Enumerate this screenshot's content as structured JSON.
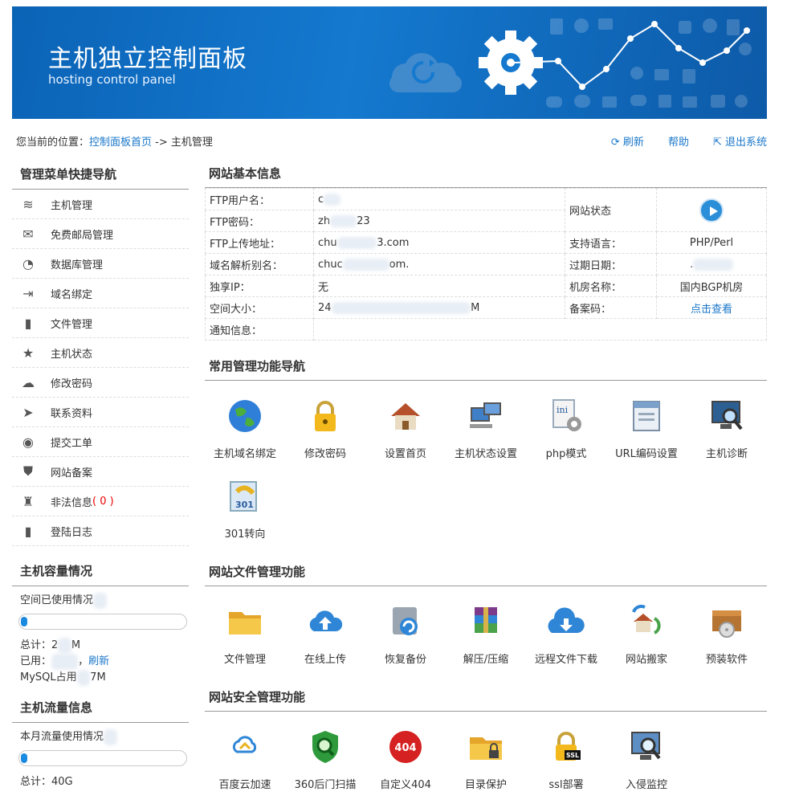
{
  "banner": {
    "title": "主机独立控制面板",
    "subtitle": "hosting control panel"
  },
  "breadcrumb": {
    "prefix": "您当前的位置：",
    "home": "控制面板首页",
    "sep": " -> ",
    "current": "主机管理"
  },
  "topnav": {
    "refresh": "刷新",
    "help": "帮助",
    "logout": "退出系统"
  },
  "sidebar": {
    "menu_title": "管理菜单快捷导航",
    "items": [
      {
        "label": "主机管理",
        "icon": "database-icon"
      },
      {
        "label": "免费邮局管理",
        "icon": "mail-icon"
      },
      {
        "label": "数据库管理",
        "icon": "pie-chart-icon"
      },
      {
        "label": "域名绑定",
        "icon": "sign-in-icon"
      },
      {
        "label": "文件管理",
        "icon": "file-icon"
      },
      {
        "label": "主机状态",
        "icon": "star-icon"
      },
      {
        "label": "修改密码",
        "icon": "cloud-refresh-icon"
      },
      {
        "label": "联系资料",
        "icon": "send-icon"
      },
      {
        "label": "提交工单",
        "icon": "user-circle-icon"
      },
      {
        "label": "网站备案",
        "icon": "shield-icon"
      },
      {
        "label": "非法信息",
        "icon": "officer-icon",
        "count": "( 0 )"
      },
      {
        "label": "登陆日志",
        "icon": "file-icon"
      }
    ],
    "capacity": {
      "title": "主机容量情况",
      "usage_label": "空间已使用情况",
      "usage_fraction": 0.02,
      "total": "总计：2",
      "total_suffix": "M",
      "used": "已用：",
      "refresh": "刷新",
      "mysql": "MySQL占用",
      "mysql_suffix": "7M"
    },
    "traffic": {
      "title": "主机流量信息",
      "usage_label": "本月流量使用情况",
      "usage_fraction": 0.02,
      "total": "总计：40G"
    }
  },
  "basic_info": {
    "title": "网站基本信息",
    "rows": [
      {
        "k": "FTP用户名：",
        "v": "c"
      },
      {
        "k": "FTP密码：",
        "v": "zh",
        "v_suffix": "23"
      },
      {
        "k": "FTP上传地址：",
        "v": "chu",
        "v_suffix": "3.com",
        "k2": "支持语言：",
        "v2": "PHP/Perl"
      },
      {
        "k": "域名解析别名：",
        "v": "chuc",
        "v_suffix": "om.",
        "k2": "过期日期：",
        "v2": "."
      },
      {
        "k": "独享IP：",
        "v": "无",
        "k2": "机房名称：",
        "v2": "国内BGP机房"
      },
      {
        "k": "空间大小：",
        "v": "24",
        "v_suffix": "M",
        "k2": "备案码：",
        "v2": "点击查看"
      },
      {
        "k": "通知信息：",
        "v": ""
      }
    ],
    "status_label": "网站状态"
  },
  "common_tools": {
    "title": "常用管理功能导航",
    "items": [
      {
        "label": "主机域名绑定",
        "icon": "globe-icon"
      },
      {
        "label": "修改密码",
        "icon": "padlock-icon"
      },
      {
        "label": "设置首页",
        "icon": "home-icon"
      },
      {
        "label": "主机状态设置",
        "icon": "computers-icon"
      },
      {
        "label": "php模式",
        "icon": "ini-gear-icon"
      },
      {
        "label": "URL编码设置",
        "icon": "window-icon"
      },
      {
        "label": "主机诊断",
        "icon": "monitor-search-icon"
      },
      {
        "label": "301转向",
        "icon": "redirect-301-icon"
      }
    ]
  },
  "file_tools": {
    "title": "网站文件管理功能",
    "items": [
      {
        "label": "文件管理",
        "icon": "folder-icon"
      },
      {
        "label": "在线上传",
        "icon": "cloud-upload-icon"
      },
      {
        "label": "恢复备份",
        "icon": "disk-restore-icon"
      },
      {
        "label": "解压/压缩",
        "icon": "archive-icon"
      },
      {
        "label": "远程文件下载",
        "icon": "cloud-download-icon"
      },
      {
        "label": "网站搬家",
        "icon": "house-move-icon"
      },
      {
        "label": "预装软件",
        "icon": "software-box-icon"
      }
    ]
  },
  "security_tools": {
    "title": "网站安全管理功能",
    "items": [
      {
        "label": "百度云加速",
        "icon": "cloud-accel-icon"
      },
      {
        "label": "360后门扫描",
        "icon": "shield-scan-icon"
      },
      {
        "label": "自定义404",
        "icon": "error-404-icon",
        "badge": "404"
      },
      {
        "label": "目录保护",
        "icon": "folder-lock-icon"
      },
      {
        "label": "ssl部署",
        "icon": "ssl-lock-icon",
        "badge": "SSL"
      },
      {
        "label": "入侵监控",
        "icon": "monitor-watch-icon"
      }
    ]
  },
  "colors": {
    "banner": "#1479cf",
    "link": "#1a77c9",
    "accent": "#1a8ae0",
    "alert": "#e00000"
  }
}
